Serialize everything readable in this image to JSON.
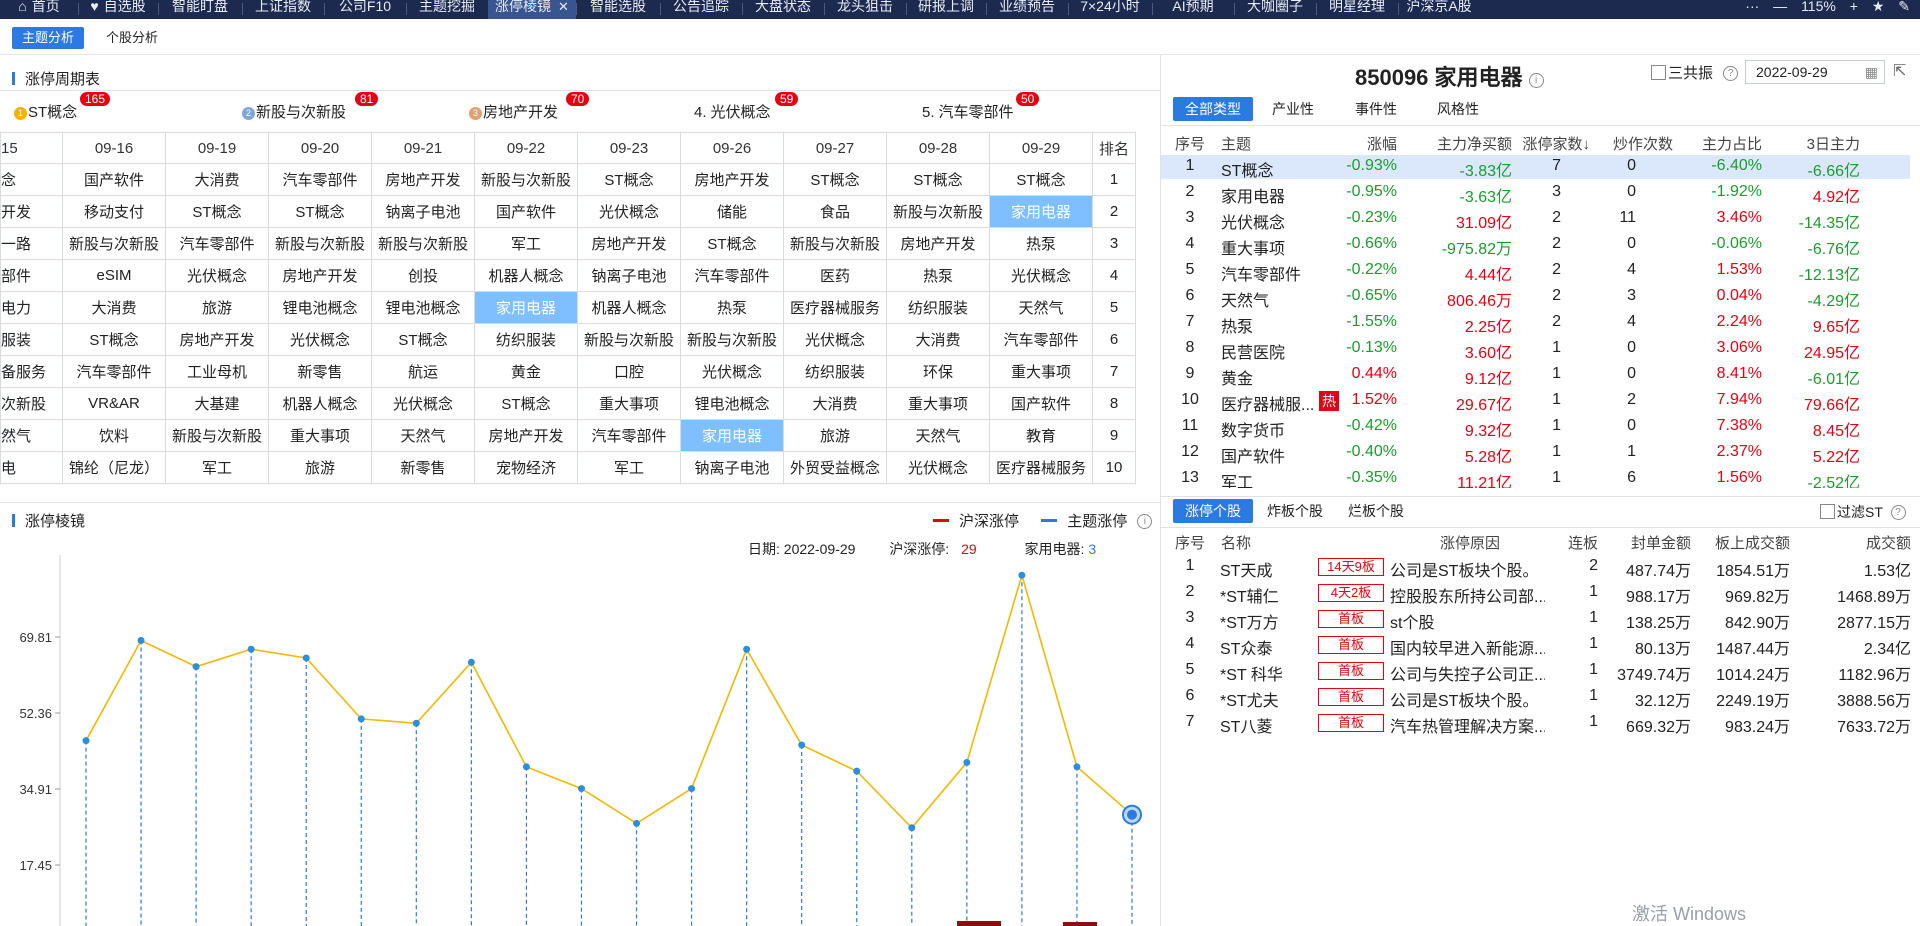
{
  "topbar": {
    "tabs": [
      {
        "label": "首页",
        "icon": "home-icon"
      },
      {
        "label": "自选股",
        "icon": "heart-icon"
      },
      {
        "label": "智能盯盘"
      },
      {
        "label": "上证指数"
      },
      {
        "label": "公司F10"
      },
      {
        "label": "主题挖掘"
      },
      {
        "label": "涨停棱镜",
        "active": true
      },
      {
        "label": "智能选股"
      },
      {
        "label": "公告追踪"
      },
      {
        "label": "大盘状态"
      },
      {
        "label": "龙头狙击"
      },
      {
        "label": "研报上调"
      },
      {
        "label": "业绩预告"
      },
      {
        "label": "7×24小时"
      },
      {
        "label": "AI预期"
      },
      {
        "label": "大咖圈子"
      },
      {
        "label": "明星经理"
      },
      {
        "label": "沪深京A股"
      }
    ],
    "zoom": "115%",
    "more": "···",
    "minus": "—",
    "plus": "+",
    "close_tab": "✕"
  },
  "subtabs": [
    "主题分析",
    "个股分析"
  ],
  "cycle": {
    "title": "涨停周期表",
    "leaders": [
      {
        "rank": "1",
        "name": "ST概念",
        "count": "165",
        "color": "#f2b400"
      },
      {
        "rank": "2",
        "name": "新股与次新股",
        "count": "81",
        "color": "#7ea7d8"
      },
      {
        "rank": "3",
        "name": "房地产开发",
        "count": "70",
        "color": "#e0a070"
      },
      {
        "rank": "4.",
        "name": "光伏概念",
        "count": "59"
      },
      {
        "rank": "5.",
        "name": "汽车零部件",
        "count": "50"
      }
    ],
    "dates": [
      "15",
      "09-16",
      "09-19",
      "09-20",
      "09-21",
      "09-22",
      "09-23",
      "09-26",
      "09-27",
      "09-28",
      "09-29"
    ],
    "rank_header": "排名",
    "rows": [
      [
        "念",
        "国产软件",
        "大消费",
        "汽车零部件",
        "房地产开发",
        "新股与次新股",
        "ST概念",
        "房地产开发",
        "ST概念",
        "ST概念",
        "ST概念",
        "1"
      ],
      [
        "开发",
        "移动支付",
        "ST概念",
        "ST概念",
        "钠离子电池",
        "国产软件",
        "光伏概念",
        "储能",
        "食品",
        "新股与次新股",
        "家用电器",
        "2"
      ],
      [
        "一路",
        "新股与次新股",
        "汽车零部件",
        "新股与次新股",
        "新股与次新股",
        "军工",
        "房地产开发",
        "ST概念",
        "新股与次新股",
        "房地产开发",
        "热泵",
        "3"
      ],
      [
        "部件",
        "eSIM",
        "光伏概念",
        "房地产开发",
        "创投",
        "机器人概念",
        "钠离子电池",
        "汽车零部件",
        "医药",
        "热泵",
        "光伏概念",
        "4"
      ],
      [
        "电力",
        "大消费",
        "旅游",
        "锂电池概念",
        "锂电池概念",
        "家用电器",
        "机器人概念",
        "热泵",
        "医疗器械服务",
        "纺织服装",
        "天然气",
        "5"
      ],
      [
        "服装",
        "ST概念",
        "房地产开发",
        "光伏概念",
        "ST概念",
        "纺织服装",
        "新股与次新股",
        "新股与次新股",
        "光伏概念",
        "大消费",
        "汽车零部件",
        "6"
      ],
      [
        "备服务",
        "汽车零部件",
        "工业母机",
        "新零售",
        "航运",
        "黄金",
        "口腔",
        "光伏概念",
        "纺织服装",
        "环保",
        "重大事项",
        "7"
      ],
      [
        "次新股",
        "VR&AR",
        "大基建",
        "机器人概念",
        "光伏概念",
        "ST概念",
        "重大事项",
        "锂电池概念",
        "大消费",
        "重大事项",
        "国产软件",
        "8"
      ],
      [
        "然气",
        "饮料",
        "新股与次新股",
        "重大事项",
        "天然气",
        "房地产开发",
        "汽车零部件",
        "家用电器",
        "旅游",
        "天然气",
        "教育",
        "9"
      ],
      [
        "电",
        "锦纶（尼龙）",
        "军工",
        "旅游",
        "新零售",
        "宠物经济",
        "军工",
        "钠离子电池",
        "外贸受益概念",
        "光伏概念",
        "医疗器械服务",
        "10"
      ]
    ]
  },
  "prism": {
    "title": "涨停棱镜",
    "legend": [
      "沪深涨停",
      "主题涨停"
    ],
    "date_label": "日期:",
    "date": "2022-09-29",
    "market_label": "沪深涨停:",
    "market_value": "29",
    "theme_label": "家用电器:",
    "theme_value": "3"
  },
  "chart_data": {
    "type": "line",
    "yticks": [
      "69.81",
      "52.36",
      "34.91",
      "17.45"
    ],
    "ylim": [
      0,
      85
    ],
    "series": [
      {
        "name": "沪深涨停",
        "color": "#e60012",
        "values": [
          46,
          69,
          63,
          67,
          65,
          51,
          50,
          64,
          40,
          35,
          27,
          35,
          67,
          45,
          39,
          26,
          41,
          84,
          40,
          29
        ]
      },
      {
        "name": "主题涨停",
        "color": "#2a7ae2"
      }
    ]
  },
  "stock": {
    "title": "850096 家用电器",
    "triple": "三共振",
    "date": "2022-09-29",
    "tabs": [
      "全部类型",
      "产业性",
      "事件性",
      "风格性"
    ],
    "headers": [
      "序号",
      "主题",
      "涨幅",
      "主力净买额",
      "涨停家数↓",
      "炒作次数",
      "主力占比",
      "3日主力"
    ],
    "rows": [
      [
        "1",
        "ST概念",
        "-0.93%",
        "-3.83亿",
        "7",
        "0",
        "-6.40%",
        "-6.66亿"
      ],
      [
        "2",
        "家用电器",
        "-0.95%",
        "-3.63亿",
        "3",
        "0",
        "-1.92%",
        "4.92亿"
      ],
      [
        "3",
        "光伏概念",
        "-0.23%",
        "31.09亿",
        "2",
        "11",
        "3.46%",
        "-14.35亿"
      ],
      [
        "4",
        "重大事项",
        "-0.66%",
        "-975.82万",
        "2",
        "0",
        "-0.06%",
        "-6.76亿"
      ],
      [
        "5",
        "汽车零部件",
        "-0.22%",
        "4.44亿",
        "2",
        "4",
        "1.53%",
        "-12.13亿"
      ],
      [
        "6",
        "天然气",
        "-0.65%",
        "806.46万",
        "2",
        "3",
        "0.04%",
        "-4.29亿"
      ],
      [
        "7",
        "热泵",
        "-1.55%",
        "2.25亿",
        "2",
        "4",
        "2.24%",
        "9.65亿"
      ],
      [
        "8",
        "民营医院",
        "-0.13%",
        "3.60亿",
        "1",
        "0",
        "3.06%",
        "24.95亿"
      ],
      [
        "9",
        "黄金",
        "0.44%",
        "9.12亿",
        "1",
        "0",
        "8.41%",
        "-6.01亿"
      ],
      [
        "10",
        "医疗器械服...",
        "1.52%",
        "29.67亿",
        "1",
        "2",
        "7.94%",
        "79.66亿"
      ],
      [
        "11",
        "数字货币",
        "-0.42%",
        "9.32亿",
        "1",
        "0",
        "7.38%",
        "8.45亿"
      ],
      [
        "12",
        "国产软件",
        "-0.40%",
        "5.28亿",
        "1",
        "1",
        "2.37%",
        "5.22亿"
      ],
      [
        "13",
        "军工",
        "-0.35%",
        "11.21亿",
        "1",
        "6",
        "1.56%",
        "-2.52亿"
      ]
    ],
    "hot_tag": "热"
  },
  "limitup": {
    "tabs": [
      "涨停个股",
      "炸板个股",
      "烂板个股"
    ],
    "filter_label": "过滤ST",
    "headers": [
      "序号",
      "名称",
      "涨停原因",
      "连板",
      "封单金额",
      "板上成交额",
      "成交额"
    ],
    "rows": [
      [
        "1",
        "ST天成",
        "14天9板",
        "公司是ST板块个股。",
        "2",
        "487.74万",
        "1854.51万",
        "1.53亿"
      ],
      [
        "2",
        "*ST辅仁",
        "4天2板",
        "控股股东所持公司部...",
        "1",
        "988.17万",
        "969.82万",
        "1468.89万"
      ],
      [
        "3",
        "*ST万方",
        "首板",
        "st个股",
        "1",
        "138.25万",
        "842.90万",
        "2877.15万"
      ],
      [
        "4",
        "ST众泰",
        "首板",
        "国内较早进入新能源...",
        "1",
        "80.13万",
        "1487.44万",
        "2.34亿"
      ],
      [
        "5",
        "*ST 科华",
        "首板",
        "公司与失控子公司正...",
        "1",
        "3749.74万",
        "1014.24万",
        "1182.96万"
      ],
      [
        "6",
        "*ST尤夫",
        "首板",
        "公司是ST板块个股。",
        "1",
        "32.12万",
        "2249.19万",
        "3888.56万"
      ],
      [
        "7",
        "ST八菱",
        "首板",
        "汽车热管理解决方案...",
        "1",
        "669.32万",
        "983.24万",
        "7633.72万"
      ]
    ]
  },
  "watermark": "激活 Windows"
}
